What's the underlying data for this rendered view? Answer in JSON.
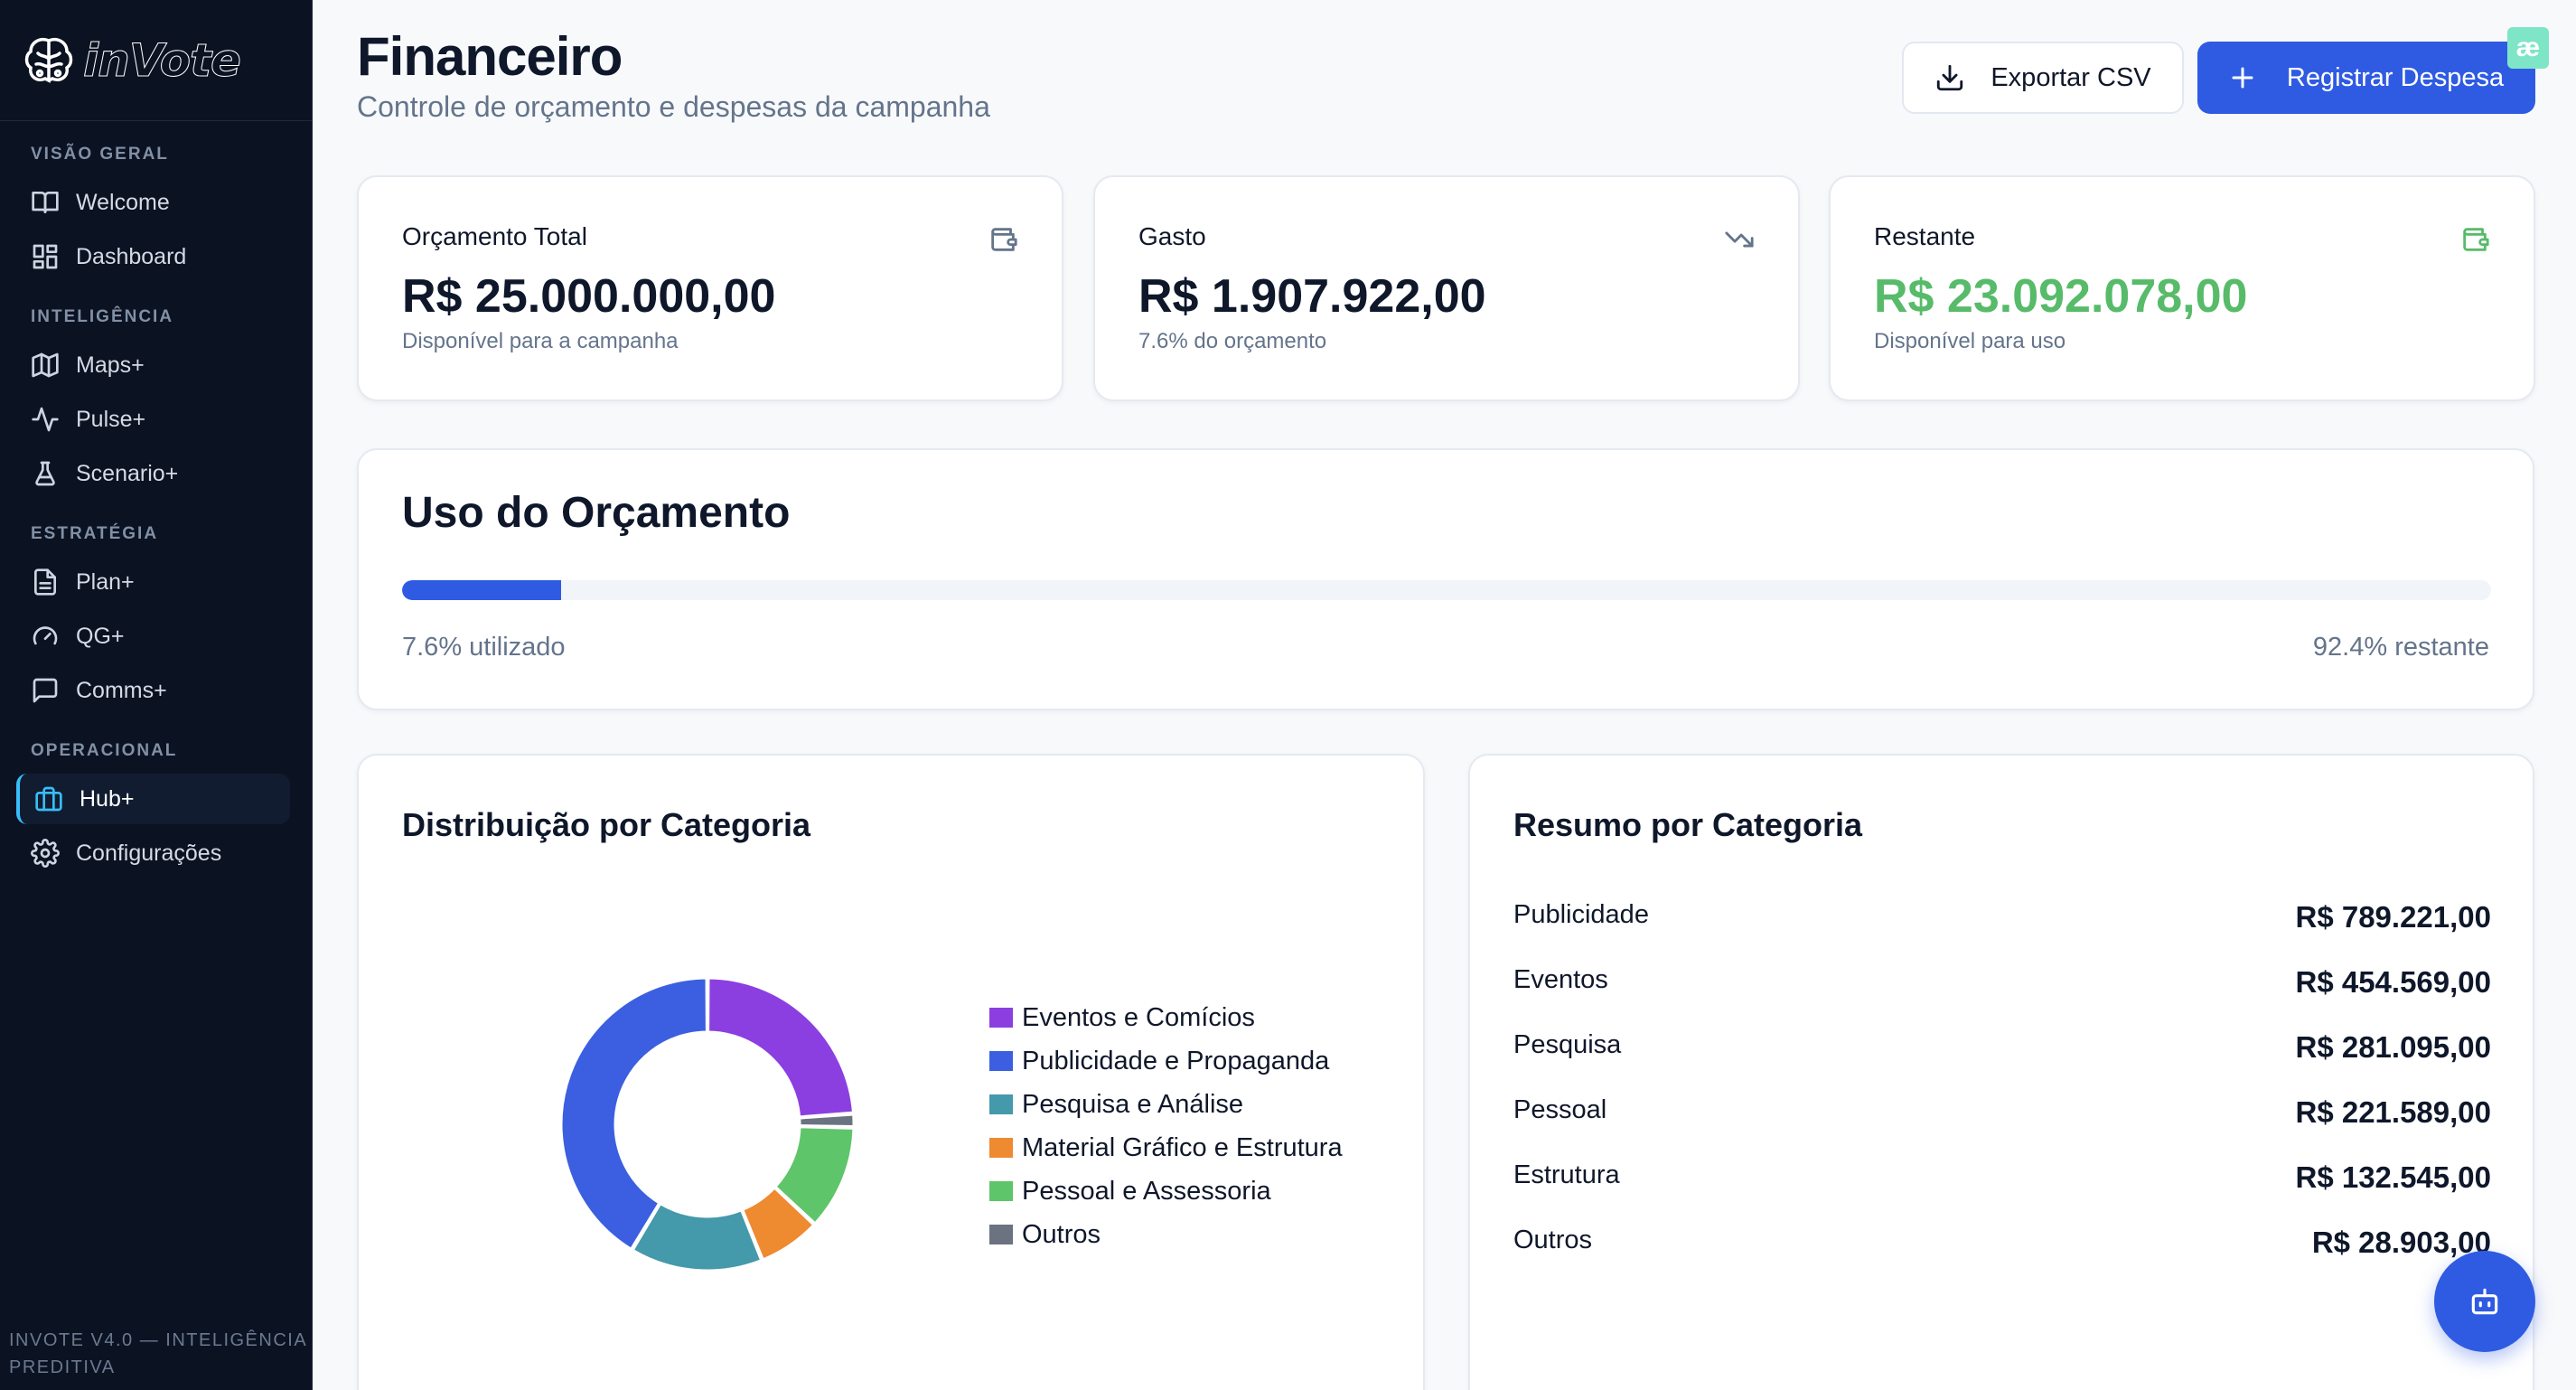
{
  "brand": {
    "name": "inVote"
  },
  "sidebar": {
    "sections": [
      {
        "label": "VISÃO GERAL",
        "items": [
          {
            "label": "Welcome",
            "icon": "book-open-icon"
          },
          {
            "label": "Dashboard",
            "icon": "layout-dashboard-icon"
          }
        ]
      },
      {
        "label": "INTELIGÊNCIA",
        "items": [
          {
            "label": "Maps+",
            "icon": "map-icon"
          },
          {
            "label": "Pulse+",
            "icon": "activity-icon"
          },
          {
            "label": "Scenario+",
            "icon": "flask-icon"
          }
        ]
      },
      {
        "label": "ESTRATÉGIA",
        "items": [
          {
            "label": "Plan+",
            "icon": "file-text-icon"
          },
          {
            "label": "QG+",
            "icon": "gauge-icon"
          },
          {
            "label": "Comms+",
            "icon": "message-square-icon"
          }
        ]
      },
      {
        "label": "OPERACIONAL",
        "items": [
          {
            "label": "Hub+",
            "icon": "briefcase-icon",
            "active": true
          },
          {
            "label": "Configurações",
            "icon": "gear-icon"
          }
        ]
      }
    ],
    "footer": "INVOTE V4.0 — INTELIGÊNCIA PREDITIVA"
  },
  "header": {
    "title": "Financeiro",
    "subtitle": "Controle de orçamento e despesas da campanha",
    "export_label": "Exportar CSV",
    "register_label": "Registrar Despesa"
  },
  "stats": [
    {
      "label": "Orçamento Total",
      "value": "R$ 25.000.000,00",
      "sub": "Disponível para a campanha",
      "icon": "wallet-icon"
    },
    {
      "label": "Gasto",
      "value": "R$ 1.907.922,00",
      "sub": "7.6% do orçamento",
      "icon": "trending-down-icon"
    },
    {
      "label": "Restante",
      "value": "R$ 23.092.078,00",
      "sub": "Disponível para uso",
      "icon": "wallet-icon",
      "accent": "#57bb6a"
    }
  ],
  "usage": {
    "title": "Uso do Orçamento",
    "used_fraction": 0.076,
    "used_label": "7.6% utilizado",
    "remaining_label": "92.4% restante"
  },
  "distribution": {
    "title": "Distribuição por Categoria"
  },
  "chart_data": {
    "type": "pie",
    "donut": true,
    "legend_position": "right",
    "categories": [
      "Eventos e Comícios",
      "Publicidade e Propaganda",
      "Pesquisa e Análise",
      "Material Gráfico e Estrutura",
      "Pessoal e Assessoria",
      "Outros"
    ],
    "values": [
      454569,
      789221,
      281095,
      132545,
      221589,
      28903
    ],
    "colors": [
      "#8b3fe0",
      "#3b5fe0",
      "#4499ab",
      "#ee8a30",
      "#5fc56a",
      "#6b7280"
    ]
  },
  "summary": {
    "title": "Resumo por Categoria",
    "rows": [
      {
        "label": "Publicidade",
        "amount": "R$ 789.221,00"
      },
      {
        "label": "Eventos",
        "amount": "R$ 454.569,00"
      },
      {
        "label": "Pesquisa",
        "amount": "R$ 281.095,00"
      },
      {
        "label": "Pessoal",
        "amount": "R$ 221.589,00"
      },
      {
        "label": "Estrutura",
        "amount": "R$ 132.545,00"
      },
      {
        "label": "Outros",
        "amount": "R$ 28.903,00"
      }
    ]
  },
  "colors": {
    "primary": "#2f5be3",
    "sidebar_bg": "#0b1222",
    "success": "#57bb6a"
  }
}
